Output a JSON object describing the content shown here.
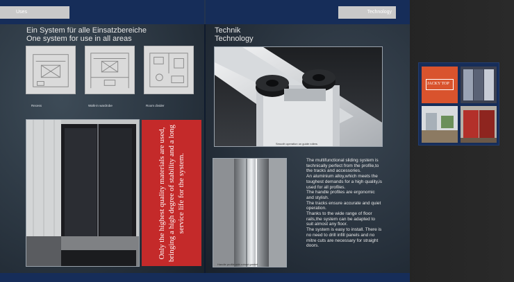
{
  "header": {
    "left_tab": "Uses",
    "right_tab": "Technology"
  },
  "left_page": {
    "title_de": "Ein System für alle Einsatzbereiche",
    "title_en": "One system for use in all areas",
    "plans": [
      {
        "caption": "Recess"
      },
      {
        "caption": "Walk-in wardrobe"
      },
      {
        "caption": "Room divider"
      }
    ],
    "quote": "Only the highest quality materials are used, bringing a high degree of stability and a long service life for the system.",
    "page_number": "5"
  },
  "right_page": {
    "title_de": "Technik",
    "title_en": "Technology",
    "photo_top_caption": "Smooth operation on guide rollers",
    "photo_bottom_caption": "Handle profile with robust gasket",
    "description": [
      "The multifunctional sliding system is technically perfect from the profile,to the tracks and accessories.",
      "An aluminium alloy,which meets the toughest demands for a high quality,is used for all profiles.",
      "The handle profiles are ergonomic and stylish.",
      "The tracks ensure accurate and quiet operation.",
      "Thanks to the wide range of floor rails,the system can be adapted to suit almost any floor.",
      "The system is easy to install. There is no need to drill infill panels and no mitre cuts are necessary for straight doors."
    ],
    "page_number": "6"
  },
  "catalog_thumbnail": {
    "brand": "JACKY TOP"
  },
  "colors": {
    "header_blue": "#162d59",
    "accent_red": "#c42a2a",
    "tab_gray": "#c9c9c9"
  }
}
